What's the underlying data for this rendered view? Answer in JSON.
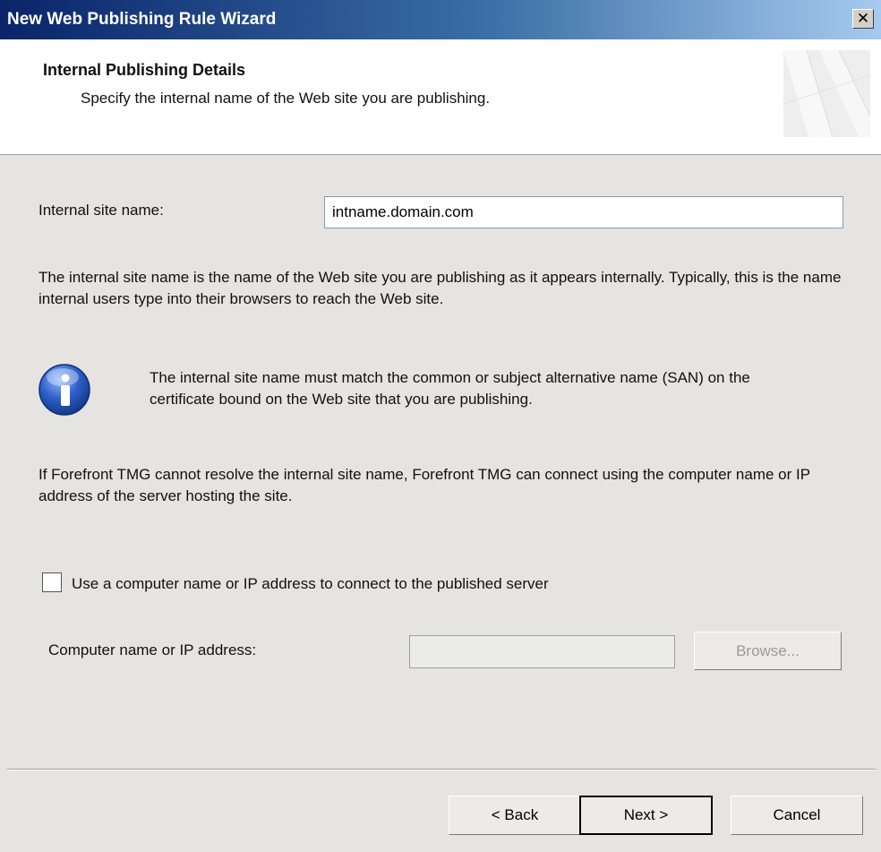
{
  "window": {
    "title": "New Web Publishing Rule Wizard",
    "close_label": "✕"
  },
  "header": {
    "title": "Internal Publishing Details",
    "subtitle": "Specify the internal name of the Web site you are publishing."
  },
  "form": {
    "internal_site_label": "Internal site name:",
    "internal_site_value": "intname.domain.com",
    "description": "The internal site name is the name of the Web site you are publishing as it appears internally. Typically, this is the name internal users type into their browsers to reach the Web site.",
    "info_note": "The internal site name must match the common or subject alternative name (SAN) on the certificate bound on the Web site that you are publishing.",
    "resolve_note": "If Forefront TMG cannot resolve the internal site name, Forefront TMG can connect using the computer name or IP address of the server hosting the site.",
    "use_computer_checkbox_label": "Use a computer name or IP address to connect to the published server",
    "use_computer_checked": false,
    "computer_name_label": "Computer name or IP address:",
    "computer_name_value": "",
    "browse_label": "Browse..."
  },
  "footer": {
    "back_label": "< Back",
    "next_label": "Next >",
    "cancel_label": "Cancel"
  },
  "icons": {
    "info": "info-icon",
    "header_art": "wizard-banner-icon",
    "close": "close-icon"
  },
  "colors": {
    "title_bar": "#0a246a",
    "info_blue": "#1d4fb0",
    "window_bg": "#e6e4e0"
  }
}
